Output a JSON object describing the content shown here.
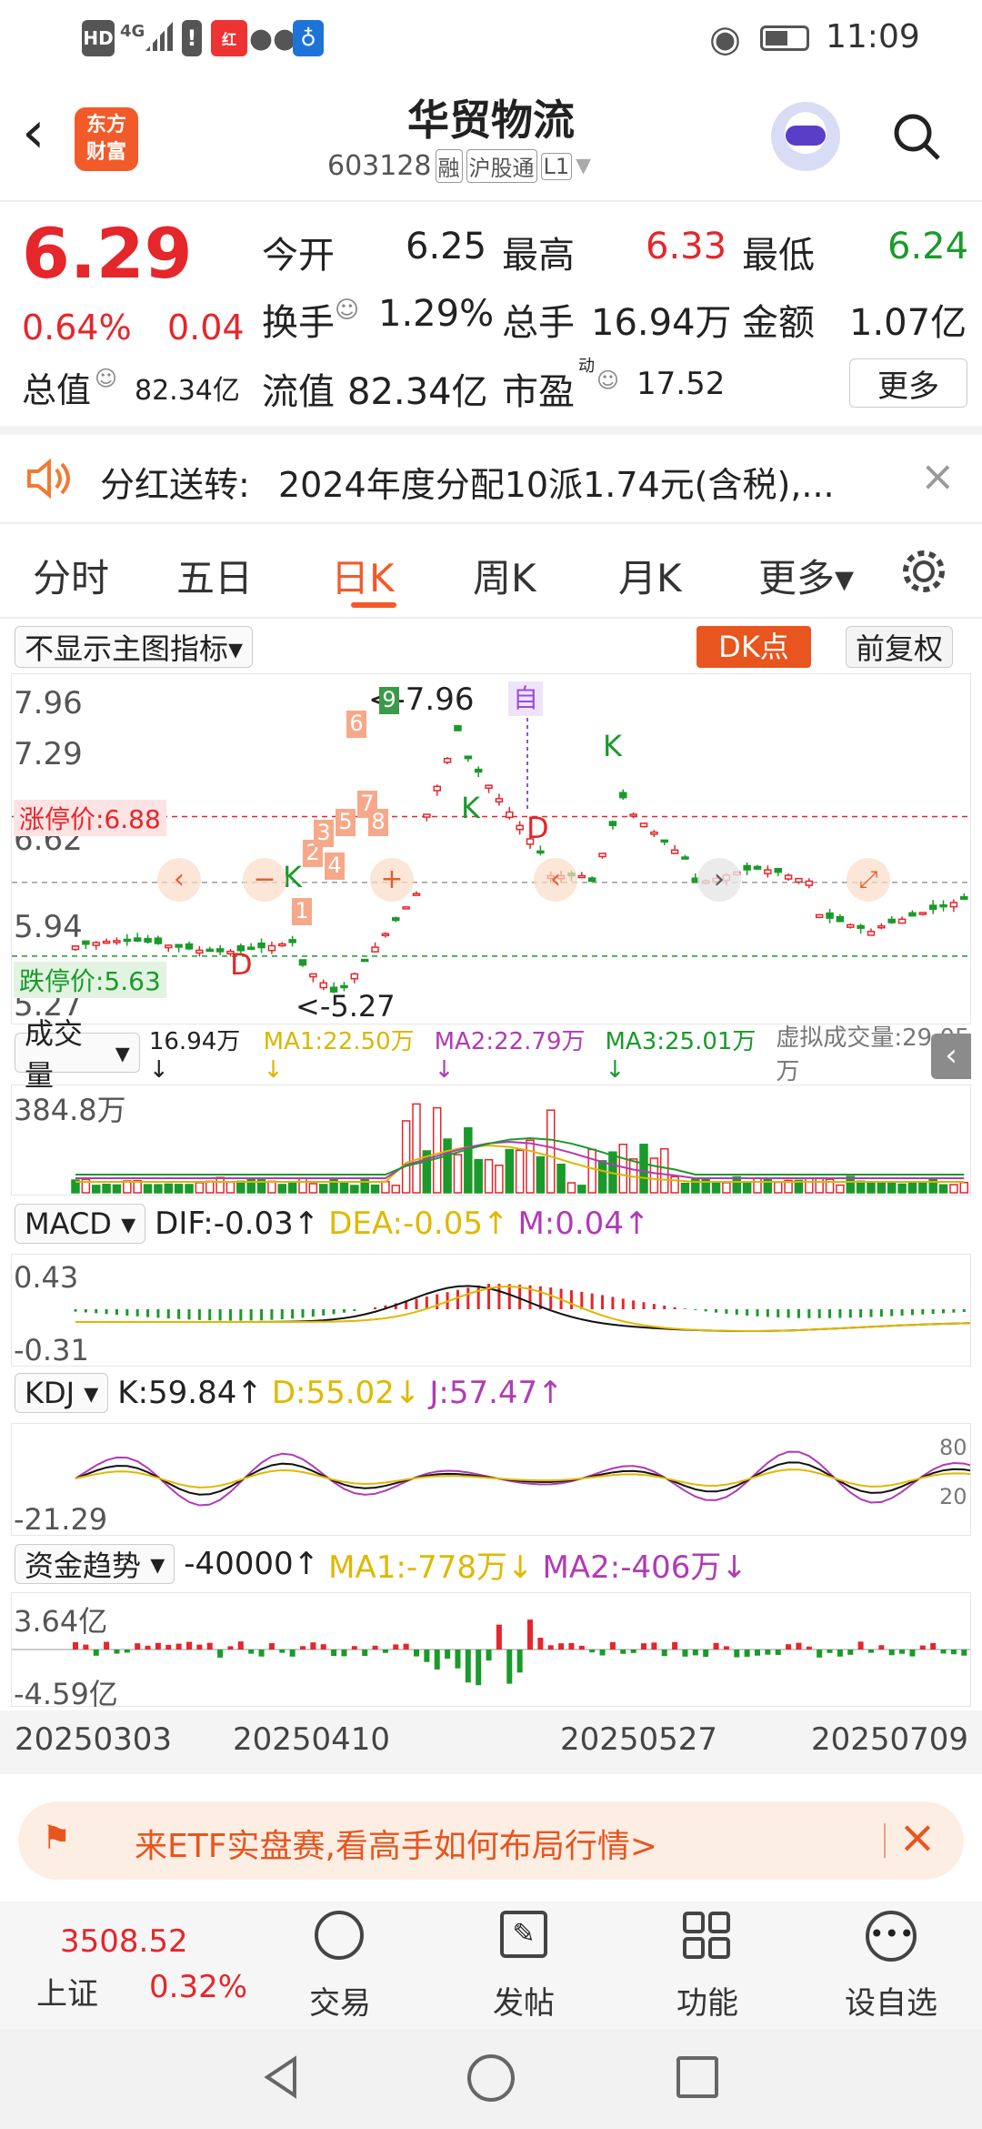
{
  "status": {
    "hd": "HD",
    "net": "4G",
    "time": "11:09"
  },
  "header": {
    "name": "华贸物流",
    "code": "603128",
    "tags": [
      "融",
      "沪股通",
      "L1"
    ],
    "logo_line1": "东方",
    "logo_line2": "财富"
  },
  "quote": {
    "price": "6.29",
    "pct": "0.64%",
    "chg": "0.04",
    "rows": [
      [
        {
          "k": "今开",
          "v": "6.25",
          "c": "n"
        },
        {
          "k": "最高",
          "v": "6.33",
          "c": "r"
        },
        {
          "k": "最低",
          "v": "6.24",
          "c": "g"
        }
      ],
      [
        {
          "k": "换手",
          "v": "1.29%",
          "c": "n"
        },
        {
          "k": "总手",
          "v": "16.94万",
          "c": "n"
        },
        {
          "k": "金额",
          "v": "1.07亿",
          "c": "n"
        }
      ]
    ],
    "total_label": "总值",
    "total_val": "82.34亿",
    "float_label": "流值",
    "float_val": "82.34亿",
    "pe_label": "市盈",
    "pe_sup": "动",
    "pe_val": "17.52",
    "more": "更多"
  },
  "notice": {
    "label": "分红送转:",
    "text": "2024年度分配10派1.74元(含税),..."
  },
  "tabs": [
    "分时",
    "五日",
    "日K",
    "周K",
    "月K",
    "更多▾"
  ],
  "chart": {
    "indicator": "不显示主图指标▾",
    "dk": "DK点",
    "fq": "前复权",
    "y_labels": [
      "7.96",
      "7.29",
      "6.62",
      "5.94",
      "5.27"
    ],
    "limit_up": "涨停价:6.88",
    "limit_down": "跌停价:5.63",
    "max_label": "<-7.96",
    "min_label": "<-5.27",
    "self": "自",
    "seq": [
      "1",
      "2",
      "3",
      "4",
      "5",
      "6",
      "7",
      "8",
      "9"
    ],
    "k_marks": [
      "K",
      "K",
      "K"
    ],
    "d_marks": [
      "D",
      "D"
    ]
  },
  "volume": {
    "name": "成交量",
    "vals": "16.94万↓",
    "ma1": "MA1:22.50万↓",
    "ma2": "MA2:22.79万↓",
    "ma3": "MA3:25.01万↓",
    "virtual": "虚拟成交量:29.05万",
    "top": "384.8万"
  },
  "macd": {
    "name": "MACD",
    "dif": "DIF:-0.03↑",
    "dea": "DEA:-0.05↑",
    "m": "M:0.04↑",
    "top": "0.43",
    "bottom": "-0.31"
  },
  "kdj": {
    "name": "KDJ",
    "k": "K:59.84↑",
    "d": "D:55.02↓",
    "j": "J:57.47↑",
    "bottom": "-21.29",
    "r80": "80",
    "r20": "20"
  },
  "fund": {
    "name": "资金趋势",
    "val": "-40000↑",
    "ma1": "MA1:-778万↓",
    "ma2": "MA2:-406万↓",
    "top": "3.64亿",
    "bottom": "-4.59亿"
  },
  "dates": [
    "20250303",
    "20250410",
    "20250527",
    "20250709"
  ],
  "banner": {
    "text": "来ETF实盘赛,看高手如何布局行情>"
  },
  "nav": {
    "index_val": "3508.52",
    "index_name": "上证",
    "index_pct": "0.32%",
    "items": [
      "交易",
      "发帖",
      "功能",
      "设自选"
    ]
  }
}
